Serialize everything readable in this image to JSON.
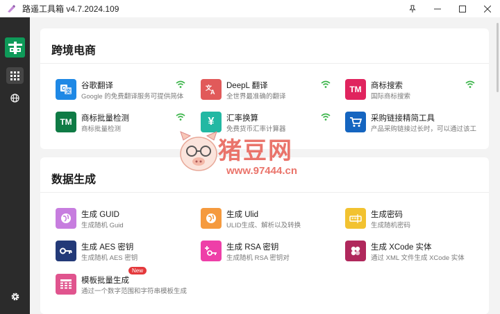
{
  "window": {
    "title": "路遥工具箱 v4.7.2024.109",
    "buttons": [
      "pin",
      "minimize",
      "maximize",
      "close"
    ]
  },
  "sidebar": {
    "items": [
      {
        "name": "apps-grid-icon",
        "active": true
      },
      {
        "name": "globe-icon",
        "active": false
      }
    ],
    "bottom": "gear-icon"
  },
  "sections": [
    {
      "title": "跨境电商",
      "tools": [
        {
          "name": "谷歌翻译",
          "desc": "Google 的免费翻译服务可提供简体",
          "icon": "translate-icon",
          "color": "#1e88e5",
          "wifi": true
        },
        {
          "name": "DeepL 翻译",
          "desc": "全世界最准确的翻译",
          "icon": "translate-icon",
          "color": "#e15a5a",
          "wifi": true
        },
        {
          "name": "商标搜索",
          "desc": "国际商标搜索",
          "icon": "tm-icon",
          "color": "#e0245e",
          "wifi": true,
          "icon_text": "TM"
        },
        {
          "name": "商标批量检测",
          "desc": "商标批量检测",
          "icon": "tm-icon",
          "color": "#0f7b45",
          "wifi": true,
          "icon_text": "TM"
        },
        {
          "name": "汇率换算",
          "desc": "免费货币汇率计算器",
          "icon": "yen-icon",
          "color": "#22b8a3",
          "wifi": true,
          "icon_text": "¥"
        },
        {
          "name": "采购链接精简工具",
          "desc": "产品采购链接过长时，可以通过该工",
          "icon": "cart-icon",
          "color": "#1565c0",
          "wifi": false
        }
      ]
    },
    {
      "title": "数据生成",
      "tools": [
        {
          "name": "生成 GUID",
          "desc": "生成随机 Guid",
          "icon": "globe-icon",
          "color": "#c77ddf"
        },
        {
          "name": "生成 Ulid",
          "desc": "ULID生成、解析以及转换",
          "icon": "globe-icon",
          "color": "#f59a3e"
        },
        {
          "name": "生成密码",
          "desc": "生成随机密码",
          "icon": "password-icon",
          "color": "#f2c230"
        },
        {
          "name": "生成 AES 密钥",
          "desc": "生成随机 AES 密钥",
          "icon": "key-icon",
          "color": "#233a78"
        },
        {
          "name": "生成 RSA 密钥",
          "desc": "生成随机 RSA 密钥对",
          "icon": "key-plus-icon",
          "color": "#ee3fa8"
        },
        {
          "name": "生成 XCode 实体",
          "desc": "通过 XML 文件生成 XCode 实体",
          "icon": "puzzle-icon",
          "color": "#b0285c"
        },
        {
          "name": "模板批量生成",
          "desc": "通过一个数字范围和字符串模板生成",
          "icon": "table-icon",
          "color": "#e0548e",
          "badge": "New"
        }
      ]
    }
  ],
  "watermark": {
    "text": "猪豆网",
    "url": "www.97444.cn"
  }
}
